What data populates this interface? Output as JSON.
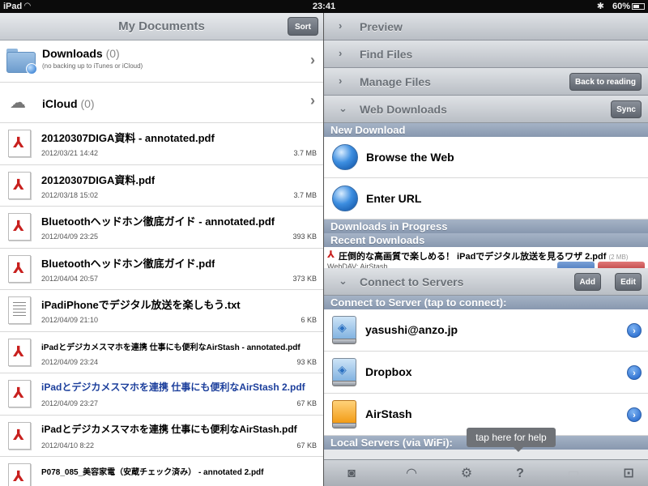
{
  "status_bar": {
    "carrier": "iPad",
    "time": "23:41",
    "battery": "60%",
    "battery_level": 0.6
  },
  "left": {
    "title": "My Documents",
    "sort_label": "Sort",
    "folders": [
      {
        "name": "Downloads",
        "count": "(0)",
        "sub": "(no backing up to iTunes or iCloud)"
      },
      {
        "name": "iCloud",
        "count": "(0)"
      }
    ],
    "files": [
      {
        "name": "20120307DIGA資料 - annotated.pdf",
        "date": "2012/03/21 14:42",
        "size": "3.7 MB"
      },
      {
        "name": "20120307DIGA資料.pdf",
        "date": "2012/03/18 15:02",
        "size": "3.7 MB"
      },
      {
        "name": "Bluetoothヘッドホン徹底ガイド - annotated.pdf",
        "date": "2012/04/09 23:25",
        "size": "393 KB"
      },
      {
        "name": "Bluetoothヘッドホン徹底ガイド.pdf",
        "date": "2012/04/04 20:57",
        "size": "373 KB"
      },
      {
        "name": "iPadiPhoneでデジタル放送を楽しもう.txt",
        "date": "2012/04/09 21:10",
        "size": "6 KB"
      },
      {
        "name": "iPadとデジカメスマホを連携 仕事にも便利なAirStash - annotated.pdf",
        "date": "2012/04/09 23:24",
        "size": "93 KB"
      },
      {
        "name": "iPadとデジカメスマホを連携 仕事にも便利なAirStash 2.pdf",
        "date": "2012/04/09 23:27",
        "size": "67 KB"
      },
      {
        "name": "iPadとデジカメスマホを連携 仕事にも便利なAirStash.pdf",
        "date": "2012/04/10 8:22",
        "size": "67 KB"
      },
      {
        "name": "P078_085_美容家電（安蔵チェック済み） - annotated 2.pdf",
        "date": "",
        "size": ""
      }
    ]
  },
  "right": {
    "sections": {
      "preview": "Preview",
      "find_files": "Find Files",
      "manage_files": "Manage Files",
      "back_to_reading": "Back to reading",
      "web_downloads": "Web Downloads",
      "sync": "Sync",
      "connect_to_servers": "Connect to Servers",
      "add": "Add",
      "edit": "Edit"
    },
    "new_download": "New Download",
    "browse_web": "Browse the Web",
    "enter_url": "Enter URL",
    "downloads_in_progress": "Downloads in Progress",
    "recent_downloads": "Recent Downloads",
    "recent_item": {
      "name": "圧倒的な高画質で楽しめる！ iPadでデジタル放送を見るワザ 2.pdf",
      "size": "(2 MB)",
      "source": "WebDAV: AirStash"
    },
    "connect_to_server_hint": "Connect to Server (tap to connect):",
    "servers": [
      {
        "name": "yasushi@anzo.jp"
      },
      {
        "name": "Dropbox"
      },
      {
        "name": "AirStash"
      }
    ],
    "local_servers": "Local Servers (via WiFi):",
    "tooltip": "tap here for help"
  }
}
